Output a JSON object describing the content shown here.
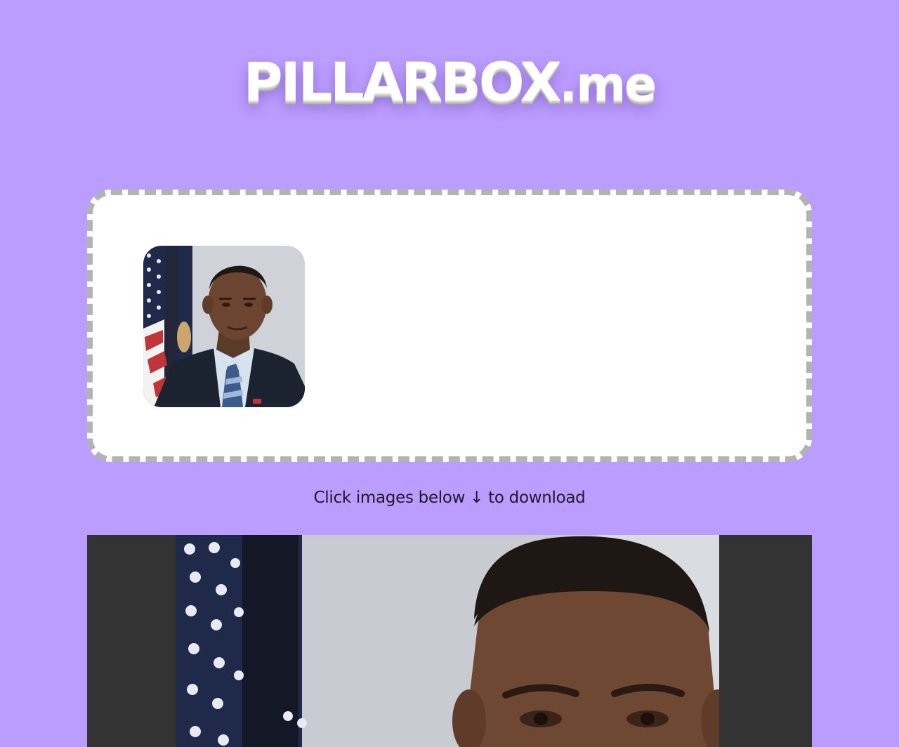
{
  "header": {
    "logo_main": "PILLARBOX",
    "logo_tld": ".me"
  },
  "uploader": {
    "thumbnail_icon": "portrait-thumbnail"
  },
  "hint": {
    "text": "Click images below ↓ to download"
  },
  "colors": {
    "background": "#bb9cff",
    "dropzone_bg": "#ffffff",
    "dropzone_border": "#b3b3b3",
    "pillarbox_bars": "#333333",
    "hint_text": "#1e1a2e"
  }
}
